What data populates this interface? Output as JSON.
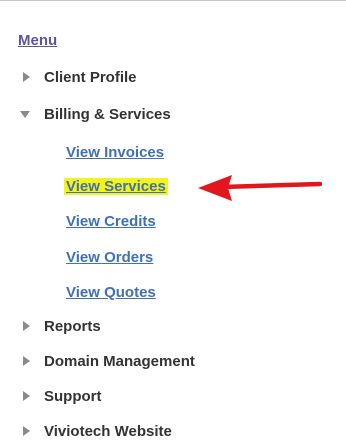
{
  "menu": {
    "title": "Menu",
    "items": [
      {
        "label": "Client Profile"
      },
      {
        "label": "Billing & Services",
        "subitems": [
          {
            "label": "View Invoices"
          },
          {
            "label": "View Services"
          },
          {
            "label": "View Credits"
          },
          {
            "label": "View Orders"
          },
          {
            "label": "View Quotes"
          }
        ]
      },
      {
        "label": "Reports"
      },
      {
        "label": "Domain Management"
      },
      {
        "label": "Support"
      },
      {
        "label": "Viviotech Website"
      }
    ]
  },
  "colors": {
    "link": "#3f70b8",
    "heading": "#5b55a8",
    "highlight": "#f4f31a",
    "arrow": "#e3161e"
  },
  "annotation": {
    "icon": "red-arrow-icon"
  }
}
